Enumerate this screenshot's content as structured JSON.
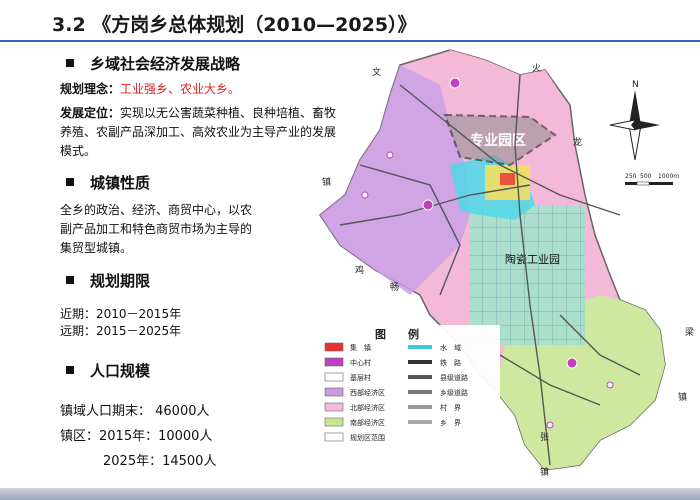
{
  "title": "3.2 《方岗乡总体规划（2010—2025）》",
  "sections": {
    "strategy": {
      "heading": "乡域社会经济发展战略",
      "concept_label": "规划理念：",
      "concept_value": "工业强乡、农业大乡。",
      "position_label": "发展定位：",
      "position_line1": "实现以无公害蔬菜种植、良种培植、畜牧",
      "position_line2": "养殖、农副产品深加工、高效农业为主导产业的发展",
      "position_line3": "模式。"
    },
    "nature": {
      "heading": "城镇性质",
      "line1": "全乡的政治、经济、商贸中心，以农",
      "line2": "副产品加工和特色商贸市场为主导的",
      "line3": "集贸型城镇。"
    },
    "period": {
      "heading": "规划期限",
      "near": "近期：2010－2015年",
      "far": "远期：2015－2025年"
    },
    "population": {
      "heading": "人口规模",
      "county": "镇域人口期末： 46000人",
      "town_2015": "镇区：2015年：10000人",
      "town_2025": "2025年：14500人"
    }
  },
  "map": {
    "zone_label_park": "专业园区",
    "zone_label_industry": "陶瓷工业园",
    "compass_label": "N",
    "scale_labels": [
      "250",
      "500",
      "1000m"
    ],
    "legend_title": "图　　例",
    "legend_items": [
      {
        "label": "集　镇",
        "color": "#e83030"
      },
      {
        "label": "中心村",
        "color": "#c040c0"
      },
      {
        "label": "基层村",
        "color": "#ffffff"
      },
      {
        "label": "西部经济区",
        "color": "#c89be0"
      },
      {
        "label": "北部经济区",
        "color": "#f5b8d8"
      },
      {
        "label": "南部经济区",
        "color": "#c8e890"
      },
      {
        "label": "规划区范围",
        "color": "#ffffff"
      }
    ],
    "legend_items_right": [
      {
        "label": "水　域",
        "color": "#40c8e0"
      },
      {
        "label": "铁　路",
        "color": "#333333"
      },
      {
        "label": "县级道路",
        "color": "#555555"
      },
      {
        "label": "乡级道路",
        "color": "#777777"
      },
      {
        "label": "村　界",
        "color": "#999999"
      },
      {
        "label": "乡　界",
        "color": "#aaaaaa"
      }
    ],
    "edge_chars": [
      "文",
      "火",
      "龙",
      "镇",
      "鸡",
      "畅",
      "梁",
      "镇",
      "张",
      "镇"
    ],
    "colors": {
      "west": "#c9a0e8",
      "north": "#f4b8d8",
      "south": "#cfe8a0",
      "water": "#4fd8e8",
      "grid": "#a8e0cc"
    }
  }
}
